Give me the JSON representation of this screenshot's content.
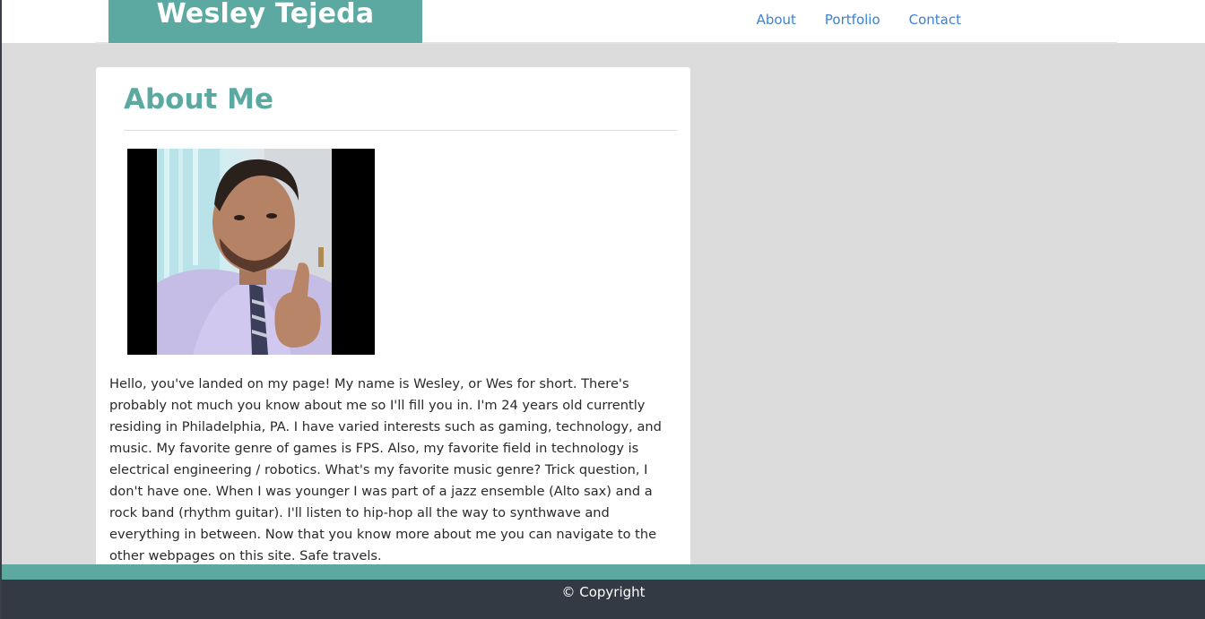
{
  "header": {
    "brand": "Wesley Tejeda",
    "nav": [
      {
        "label": "About"
      },
      {
        "label": "Portfolio"
      },
      {
        "label": "Contact"
      }
    ]
  },
  "main": {
    "title": "About Me",
    "photo_alt": "Photo of Wesley giving a thumbs up",
    "bio": "Hello, you've landed on my page! My name is Wesley, or Wes for short. There's probably not much you know about me so I'll fill you in. I'm 24 years old currently residing in Philadelphia, PA. I have varied interests such as gaming, technology, and music. My favorite genre of games is FPS. Also, my favorite field in technology is electrical engineering / robotics. What's my favorite music genre? Trick question, I don't have one. When I was younger I was part of a jazz ensemble (Alto sax) and a rock band (rhythm guitar). I'll listen to hip-hop all the way to synthwave and everything in between. Now that you know more about me you can navigate to the other webpages on this site. Safe travels."
  },
  "footer": {
    "copyright": "© Copyright"
  },
  "colors": {
    "accent": "#5ba9a0",
    "link": "#3b82d6",
    "footer_bg": "#343a43",
    "page_bg": "#dcdcdc"
  }
}
